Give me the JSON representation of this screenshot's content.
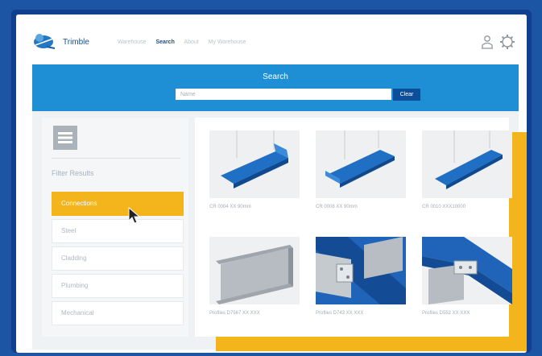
{
  "header": {
    "brand": "Trimble",
    "nav": [
      "Warehouse",
      "Search",
      "About",
      "My Warehouse"
    ],
    "active_nav": "Search"
  },
  "search": {
    "title": "Search",
    "placeholder": "Name",
    "clear_label": "Clear"
  },
  "sidebar": {
    "filter_title": "Filter Results",
    "filters": [
      "Connections",
      "Steel",
      "Cladding",
      "Plumbing",
      "Mechanical"
    ],
    "active_filter": "Connections"
  },
  "results": [
    {
      "label": "CR 0004 XX 90mm",
      "style": "tray"
    },
    {
      "label": "CR 0008 XX 90mm",
      "style": "tray"
    },
    {
      "label": "CR 0010 XXX10000",
      "style": "tray"
    },
    {
      "label": "Profiles D7567 XX XXX",
      "style": "beam"
    },
    {
      "label": "Profiles D743 XX XXX",
      "style": "connection"
    },
    {
      "label": "Profiles D552 XX XXX",
      "style": "connection-b"
    }
  ],
  "colors": {
    "accent_blue": "#1e8fd4",
    "highlight_yellow": "#f4b41c",
    "product_blue": "#1f6fc4"
  }
}
